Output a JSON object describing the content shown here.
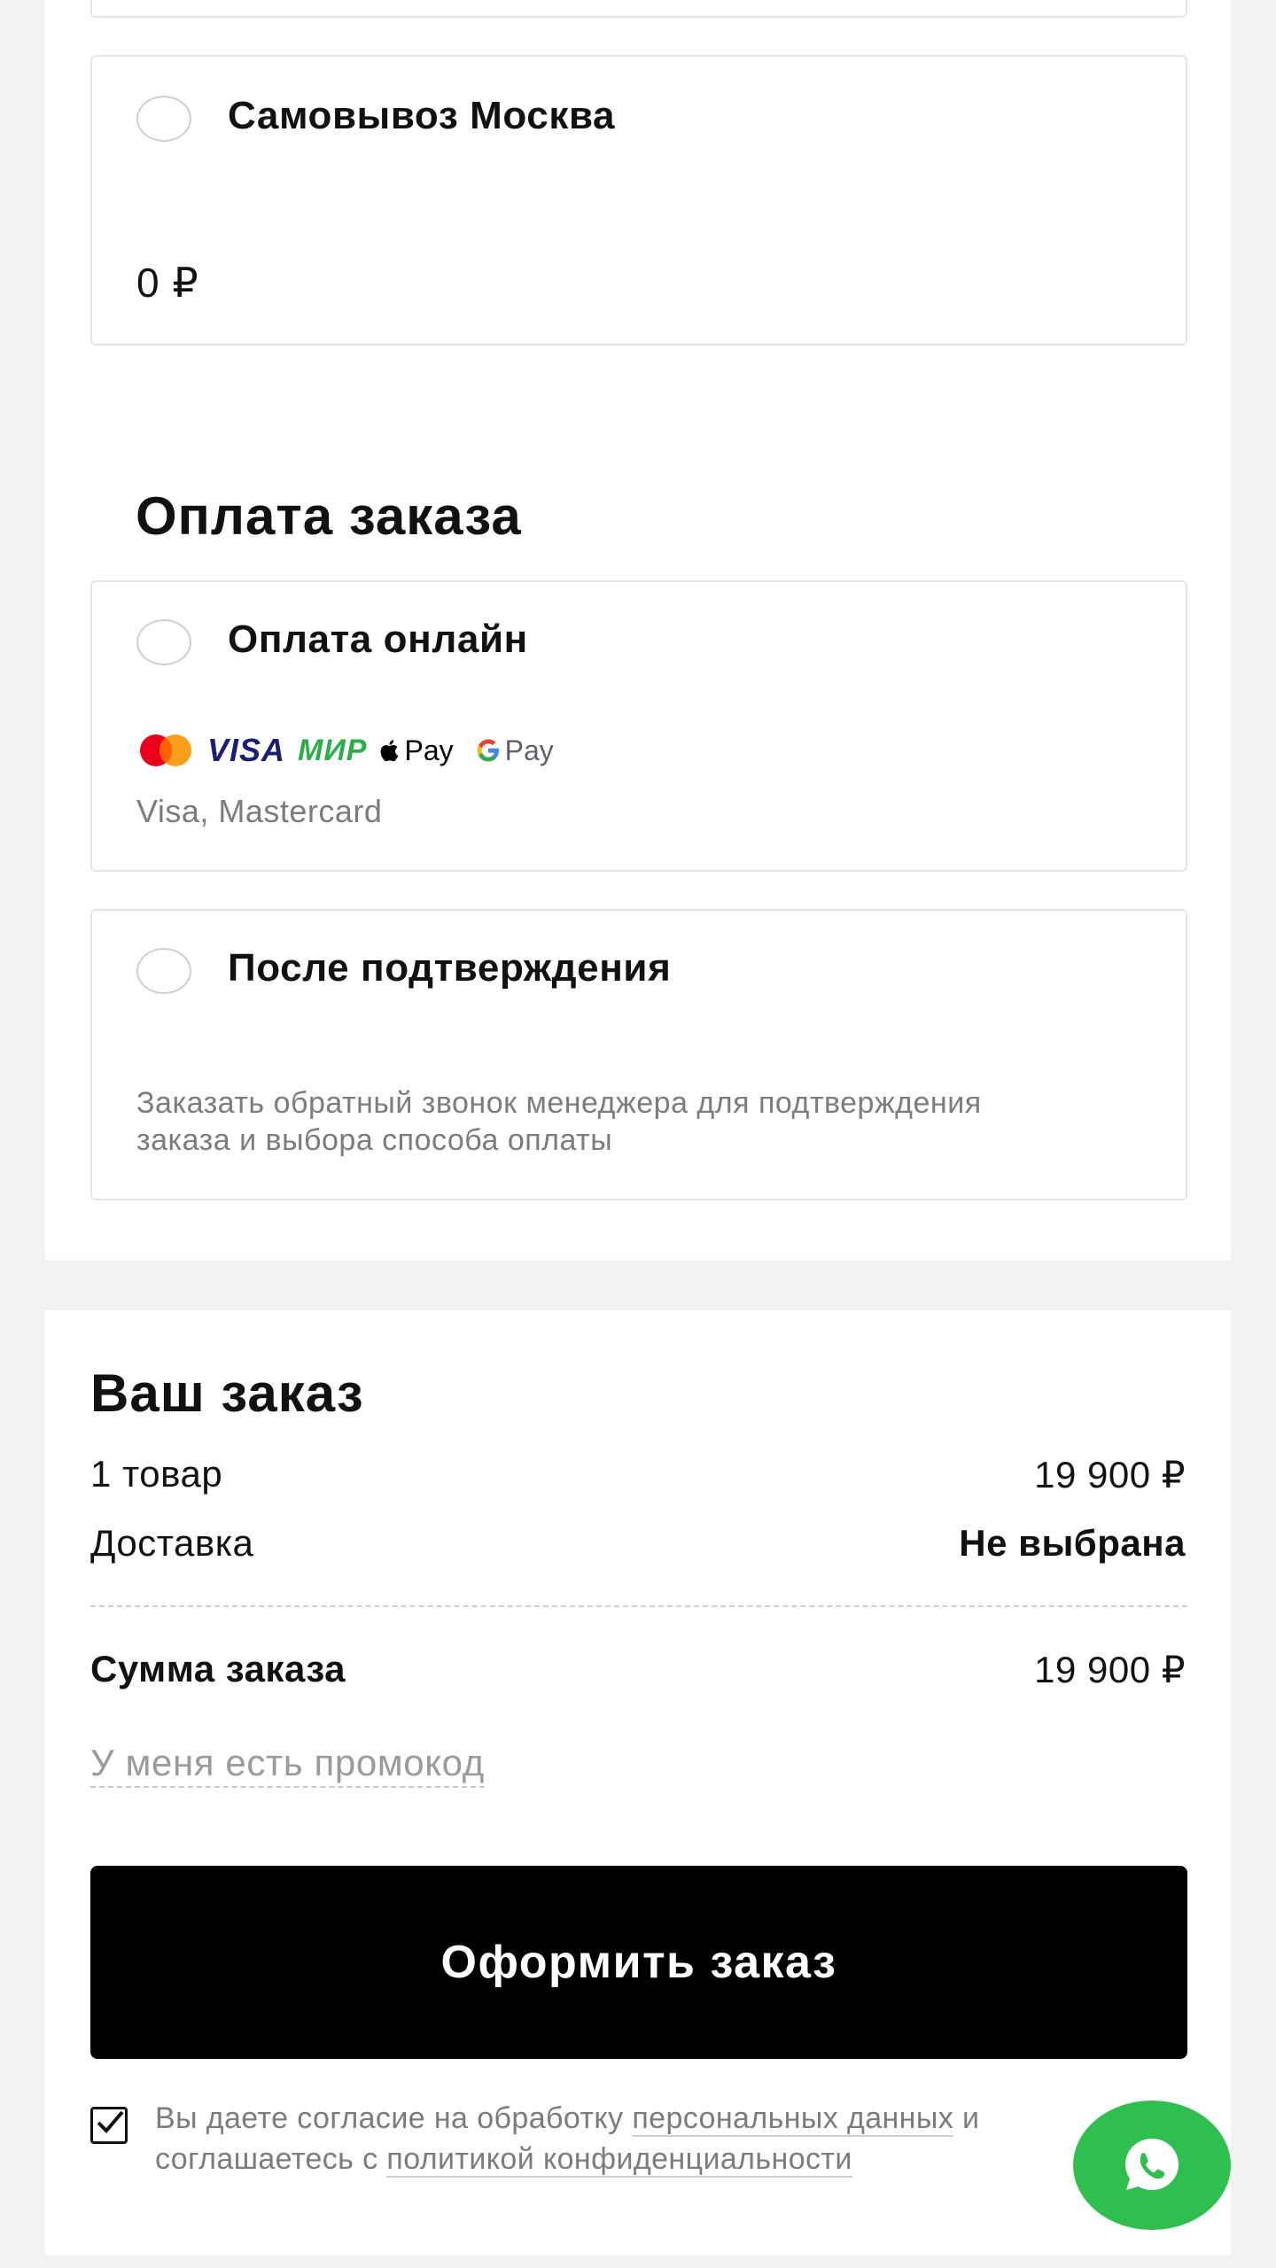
{
  "delivery": {
    "pickup": {
      "title": "Самовывоз Москва",
      "price": "0 ₽"
    }
  },
  "payment": {
    "section_title": "Оплата заказа",
    "online": {
      "title": "Оплата онлайн",
      "logos": {
        "visa": "VISA",
        "mir": "МИР",
        "apple_pay": "Pay",
        "google_pay": "Pay"
      },
      "note": "Visa, Mastercard"
    },
    "after_confirm": {
      "title": "После подтверждения",
      "description": "Заказать обратный звонок менеджера для подтверждения заказа и выбора способа оплаты"
    }
  },
  "order": {
    "title": "Ваш заказ",
    "items_label": "1 товар",
    "items_value": "19 900 ₽",
    "delivery_label": "Доставка",
    "delivery_value": "Не выбрана",
    "total_label": "Сумма заказа",
    "total_value": "19 900 ₽",
    "promo_link": "У меня есть промокод",
    "submit_label": "Оформить заказ",
    "consent": {
      "checked": true,
      "text_before": "Вы даете согласие на обработку",
      "personal_data_link": "персональных данных",
      "text_middle": "и соглашаетесь с",
      "privacy_link": "политикой конфиденциальности"
    }
  },
  "colors": {
    "page_background": "#f3f2f0",
    "button_background": "#000000",
    "whatsapp_green": "#2fbf4f",
    "muted_text": "#7c7c7c"
  },
  "icons": [
    "check-icon",
    "whatsapp-icon",
    "mastercard-icon",
    "visa-icon",
    "mir-icon",
    "apple-pay-icon",
    "google-pay-icon"
  ]
}
